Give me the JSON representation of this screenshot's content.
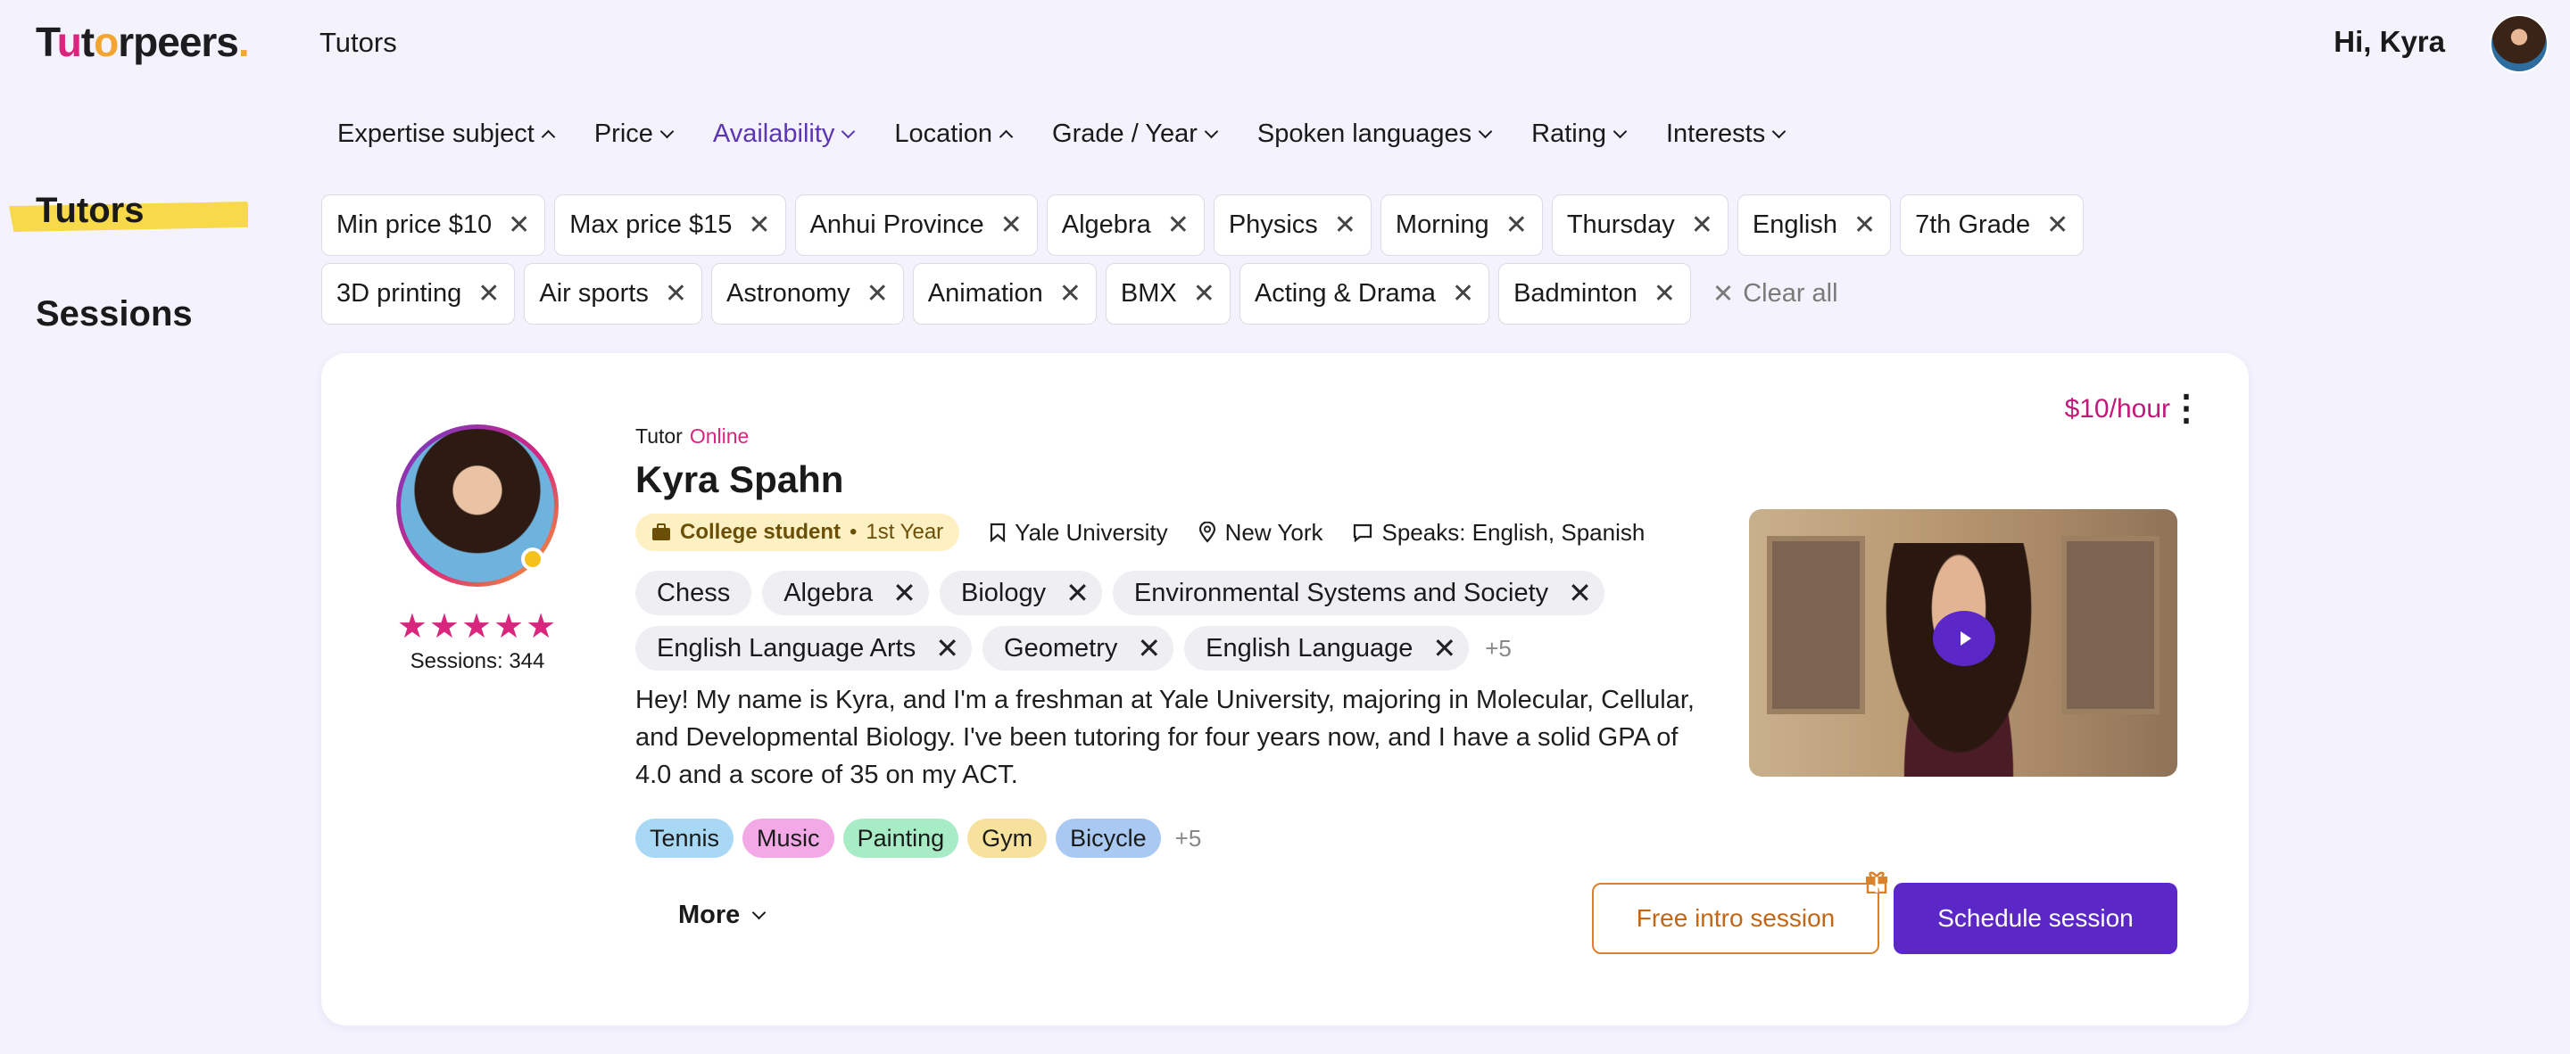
{
  "header": {
    "logo_text": "Tutorpeers",
    "page_title": "Tutors",
    "greeting": "Hi, Kyra"
  },
  "filters": [
    {
      "label": "Expertise subject",
      "state": "open"
    },
    {
      "label": "Price",
      "state": "closed"
    },
    {
      "label": "Availability",
      "state": "active"
    },
    {
      "label": "Location",
      "state": "open"
    },
    {
      "label": "Grade / Year",
      "state": "closed"
    },
    {
      "label": "Spoken languages",
      "state": "closed"
    },
    {
      "label": "Rating",
      "state": "closed"
    },
    {
      "label": "Interests",
      "state": "closed"
    }
  ],
  "sidebar": {
    "items": [
      {
        "label": "Tutors",
        "selected": true
      },
      {
        "label": "Sessions",
        "selected": false
      }
    ]
  },
  "active_chips": [
    "Min price $10",
    "Max price $15",
    "Anhui Province",
    "Algebra",
    "Physics",
    "Morning",
    "Thursday",
    "English",
    "7th Grade",
    "3D printing",
    "Air sports",
    "Astronomy",
    "Animation",
    "BMX",
    "Acting & Drama",
    "Badminton"
  ],
  "clear_all_label": "Clear all",
  "tutor": {
    "role": "Tutor",
    "status": "Online",
    "name": "Kyra Spahn",
    "rating_stars": "★★★★★",
    "rating": 5,
    "sessions": "Sessions: 344",
    "status_badge_main": "College student",
    "status_badge_sub": "1st Year",
    "university": "Yale University",
    "location": "New York",
    "languages": "Speaks: English, Spanish",
    "subjects": [
      {
        "label": "Chess",
        "removable": false
      },
      {
        "label": "Algebra",
        "removable": true
      },
      {
        "label": "Biology",
        "removable": true
      },
      {
        "label": "Environmental Systems and Society",
        "removable": true
      },
      {
        "label": "English Language Arts",
        "removable": true
      },
      {
        "label": "Geometry",
        "removable": true
      },
      {
        "label": "English Language",
        "removable": true
      }
    ],
    "subjects_more": "+5",
    "bio": "Hey! My name is Kyra, and I'm a freshman at Yale University, majoring in Molecular, Cellular, and Developmental Biology. I've been tutoring for four years now, and I have a solid GPA of 4.0 and a score of 35 on my ACT.",
    "interests": [
      {
        "label": "Tennis",
        "color": "#a9d8f5"
      },
      {
        "label": "Music",
        "color": "#f3a9e6"
      },
      {
        "label": "Painting",
        "color": "#a8ecc6"
      },
      {
        "label": "Gym",
        "color": "#f6e29d"
      },
      {
        "label": "Bicycle",
        "color": "#a9c9f2"
      }
    ],
    "interests_more": "+5",
    "more_label": "More",
    "price": "$10/hour",
    "free_intro_label": "Free intro session",
    "schedule_label": "Schedule session"
  },
  "colors": {
    "background": "#f4f2fd",
    "accent_purple": "#5b28c7",
    "accent_pink": "#d9257d",
    "accent_orange": "#d9822b",
    "marker_yellow": "#f7d94a"
  }
}
